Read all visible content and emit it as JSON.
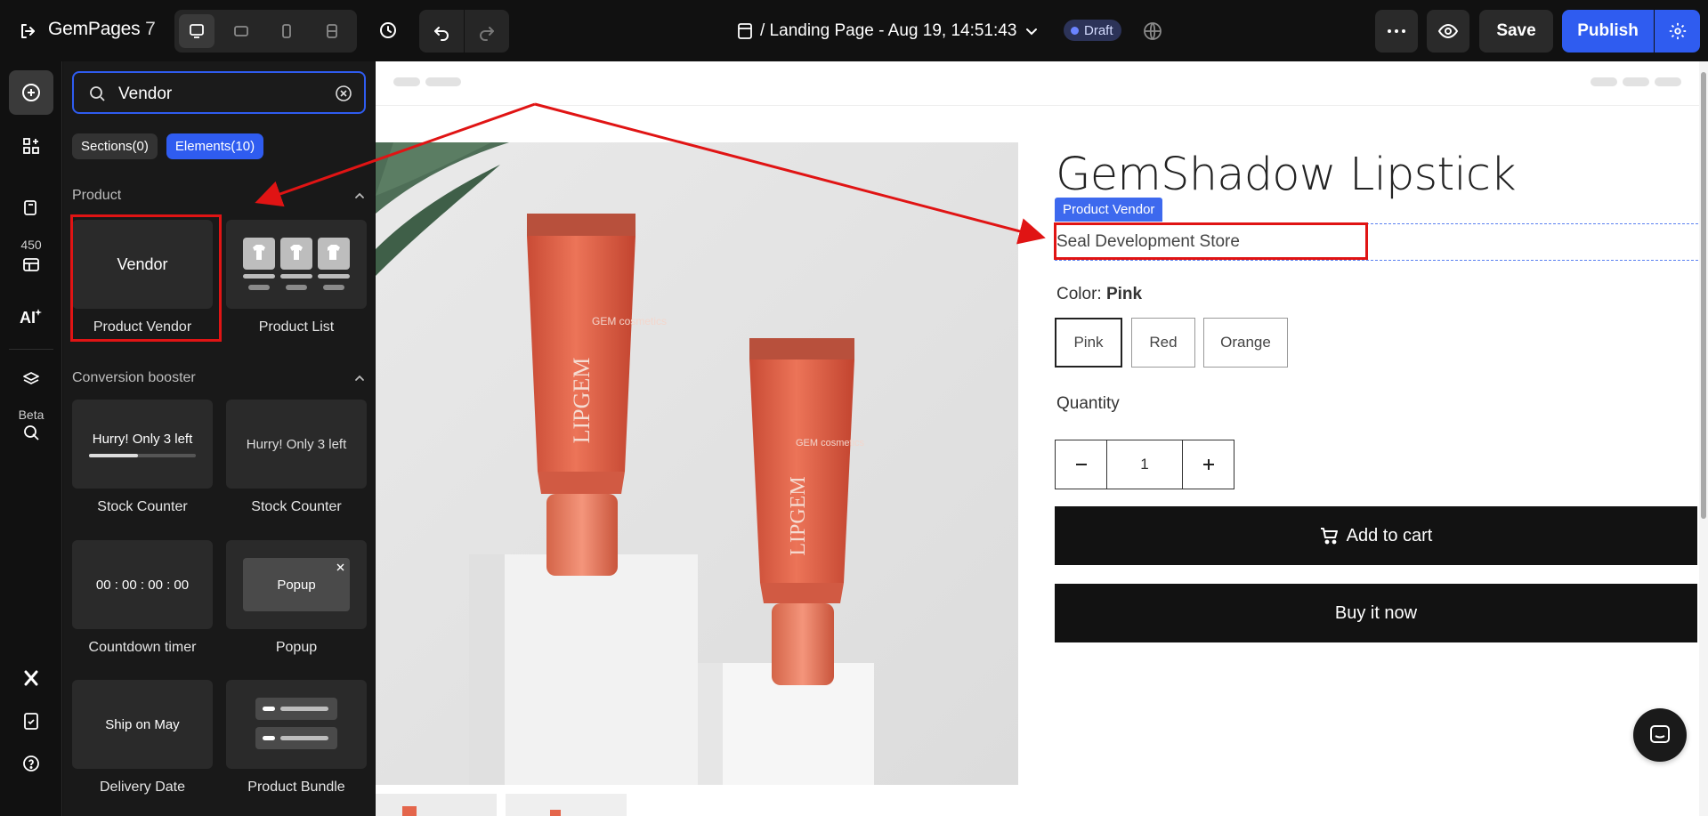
{
  "topbar": {
    "brand": "GemPages",
    "version": "7",
    "page_title": "/ Landing Page - Aug 19, 14:51:43",
    "status": "Draft",
    "save_label": "Save",
    "publish_label": "Publish"
  },
  "rail": {
    "credits_badge": "450",
    "beta_badge": "Beta"
  },
  "panel": {
    "search": {
      "value": "Vendor",
      "placeholder": ""
    },
    "tabs": [
      {
        "label": "Sections(0)",
        "active": false
      },
      {
        "label": "Elements(10)",
        "active": true
      }
    ],
    "groups": [
      {
        "title": "Product",
        "items": [
          {
            "label": "Product Vendor",
            "preview": "Vendor"
          },
          {
            "label": "Product List",
            "preview": ""
          }
        ]
      },
      {
        "title": "Conversion booster",
        "items": [
          {
            "label": "Stock Counter",
            "preview": "Hurry! Only 3 left"
          },
          {
            "label": "Stock Counter",
            "preview": "Hurry! Only 3 left"
          },
          {
            "label": "Countdown timer",
            "preview": "00 : 00 : 00 : 00"
          },
          {
            "label": "Popup",
            "preview": "Popup"
          },
          {
            "label": "Delivery Date",
            "preview": "Ship on May"
          },
          {
            "label": "Product Bundle",
            "preview": ""
          }
        ]
      }
    ]
  },
  "canvas": {
    "product_title": "GemShadow Lipstick",
    "vendor_tag": "Product Vendor",
    "vendor_value": "Seal Development Store",
    "color_label": "Color:",
    "color_value": "Pink",
    "swatches": [
      "Pink",
      "Red",
      "Orange"
    ],
    "selected_swatch": "Pink",
    "quantity_label": "Quantity",
    "quantity_value": "1",
    "add_to_cart": "Add to cart",
    "buy_now": "Buy it now",
    "tube_brand": "LIPGEM",
    "tube_logo": "GEM cosmetics"
  },
  "colors": {
    "accent": "#2f5cf0",
    "highlight": "#e01414",
    "tube": "#e4664c"
  }
}
